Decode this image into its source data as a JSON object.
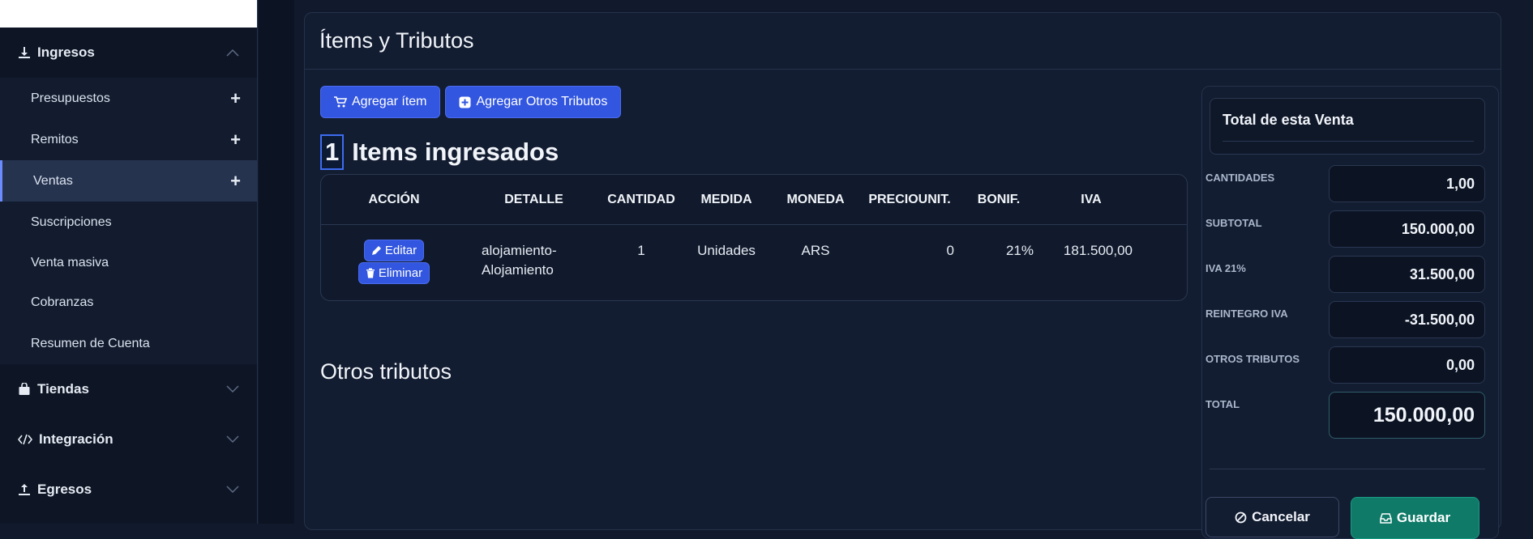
{
  "sidebar": {
    "ingresos": {
      "label": "Ingresos"
    },
    "items": [
      {
        "label": "Presupuestos",
        "has_plus": true
      },
      {
        "label": "Remitos",
        "has_plus": true
      },
      {
        "label": "Ventas",
        "has_plus": true,
        "active": true
      },
      {
        "label": "Suscripciones"
      },
      {
        "label": "Venta masiva"
      },
      {
        "label": "Cobranzas"
      },
      {
        "label": "Resumen de Cuenta"
      }
    ],
    "tiendas": {
      "label": "Tiendas"
    },
    "integracion": {
      "label": "Integración"
    },
    "egresos": {
      "label": "Egresos"
    }
  },
  "card": {
    "title": "Ítems y Tributos"
  },
  "buttons": {
    "add_item": "Agregar ítem",
    "add_tributes": "Agregar Otros Tributos"
  },
  "items": {
    "count": "1",
    "title": "Items ingresados",
    "headers": {
      "accion": "ACCIÓN",
      "detalle": "DETALLE",
      "cantidad": "CANTIDAD",
      "medida": "MEDIDA",
      "moneda": "MONEDA",
      "preciounit": "PRECIOUNIT.",
      "bonif": "BONIF.",
      "iva": "IVA"
    },
    "rows": [
      {
        "edit": "Editar",
        "delete": "Eliminar",
        "detalle_1": "alojamiento-",
        "detalle_2": "Alojamiento",
        "cantidad": "1",
        "medida": "Unidades",
        "moneda": "ARS",
        "preciounit": "0",
        "bonif": "21%",
        "iva": "181.500,00"
      }
    ]
  },
  "otros": {
    "title": "Otros tributos"
  },
  "summary": {
    "title": "Total de esta Venta",
    "cantidades_label": "CANTIDADES",
    "cantidades": "1,00",
    "subtotal_label": "SUBTOTAL",
    "subtotal": "150.000,00",
    "iva_label": "IVA 21%",
    "iva": "31.500,00",
    "reintegro_label": "REINTEGRO IVA",
    "reintegro": "-31.500,00",
    "otros_label": "OTROS TRIBUTOS",
    "otros": "0,00",
    "total_label": "TOTAL",
    "total": "150.000,00",
    "cancel": "Cancelar",
    "save": "Guardar"
  }
}
